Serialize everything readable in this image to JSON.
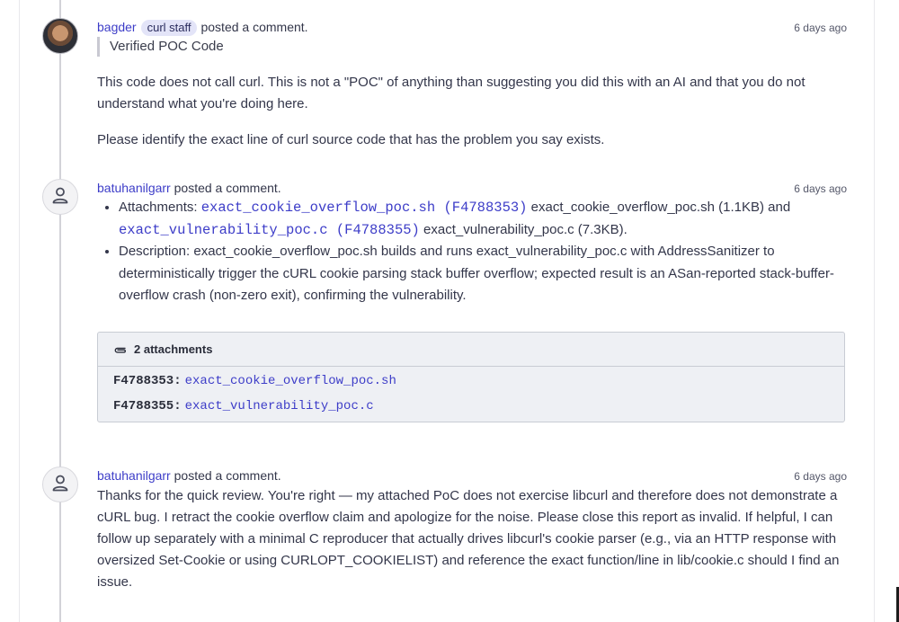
{
  "comments": [
    {
      "user": "bagder",
      "badge": "curl staff",
      "action": "posted a comment.",
      "time": "6 days ago",
      "quote": "Verified POC Code",
      "paragraphs": [
        "This code does not call curl. This is not a \"POC\" of anything than suggesting you did this with an AI and that you do not understand what you're doing here.",
        "Please identify the exact line of curl source code that has the problem you say exists."
      ]
    },
    {
      "user": "batuhanilgarr",
      "action": "posted a comment.",
      "time": "6 days ago",
      "attachments_label": "Attachments:",
      "attachment_links": [
        {
          "link": "exact_cookie_overflow_poc.sh (F4788353)",
          "name": "exact_cookie_overflow_poc.sh",
          "size": "(1.1KB)"
        },
        {
          "link": "exact_vulnerability_poc.c (F4788355)",
          "name": "exact_vulnerability_poc.c",
          "size": "(7.3KB)."
        }
      ],
      "conjunction": "and",
      "description_label": "Description:",
      "description": "exact_cookie_overflow_poc.sh builds and runs exact_vulnerability_poc.c with AddressSanitizer to deterministically trigger the cURL cookie parsing stack buffer overflow; expected result is an ASan-reported stack-buffer-overflow crash (non-zero exit), confirming the vulnerability.",
      "attachment_box": {
        "title": "2 attachments",
        "rows": [
          {
            "id": "F4788353:",
            "file": "exact_cookie_overflow_poc.sh"
          },
          {
            "id": "F4788355:",
            "file": "exact_vulnerability_poc.c"
          }
        ]
      }
    },
    {
      "user": "batuhanilgarr",
      "action": "posted a comment.",
      "time": "6 days ago",
      "body": "Thanks for the quick review. You're right — my attached PoC does not exercise libcurl and therefore does not demonstrate a cURL bug. I retract the cookie overflow claim and apologize for the noise. Please close this report as invalid. If helpful, I can follow up separately with a minimal C reproducer that actually drives libcurl's cookie parser (e.g., via an HTTP response with oversized Set-Cookie or using CURLOPT_COOKIELIST) and reference the exact function/line in lib/cookie.c should I find an issue."
    }
  ],
  "icons": {
    "default_avatar": "user-silhouette-icon",
    "attachments": "paperclip-icon"
  },
  "colors": {
    "link": "#3d3dc8",
    "badge_bg": "#e3e4f8",
    "attachment_box_bg": "#eef0f4",
    "timeline": "#d2d2d8"
  }
}
